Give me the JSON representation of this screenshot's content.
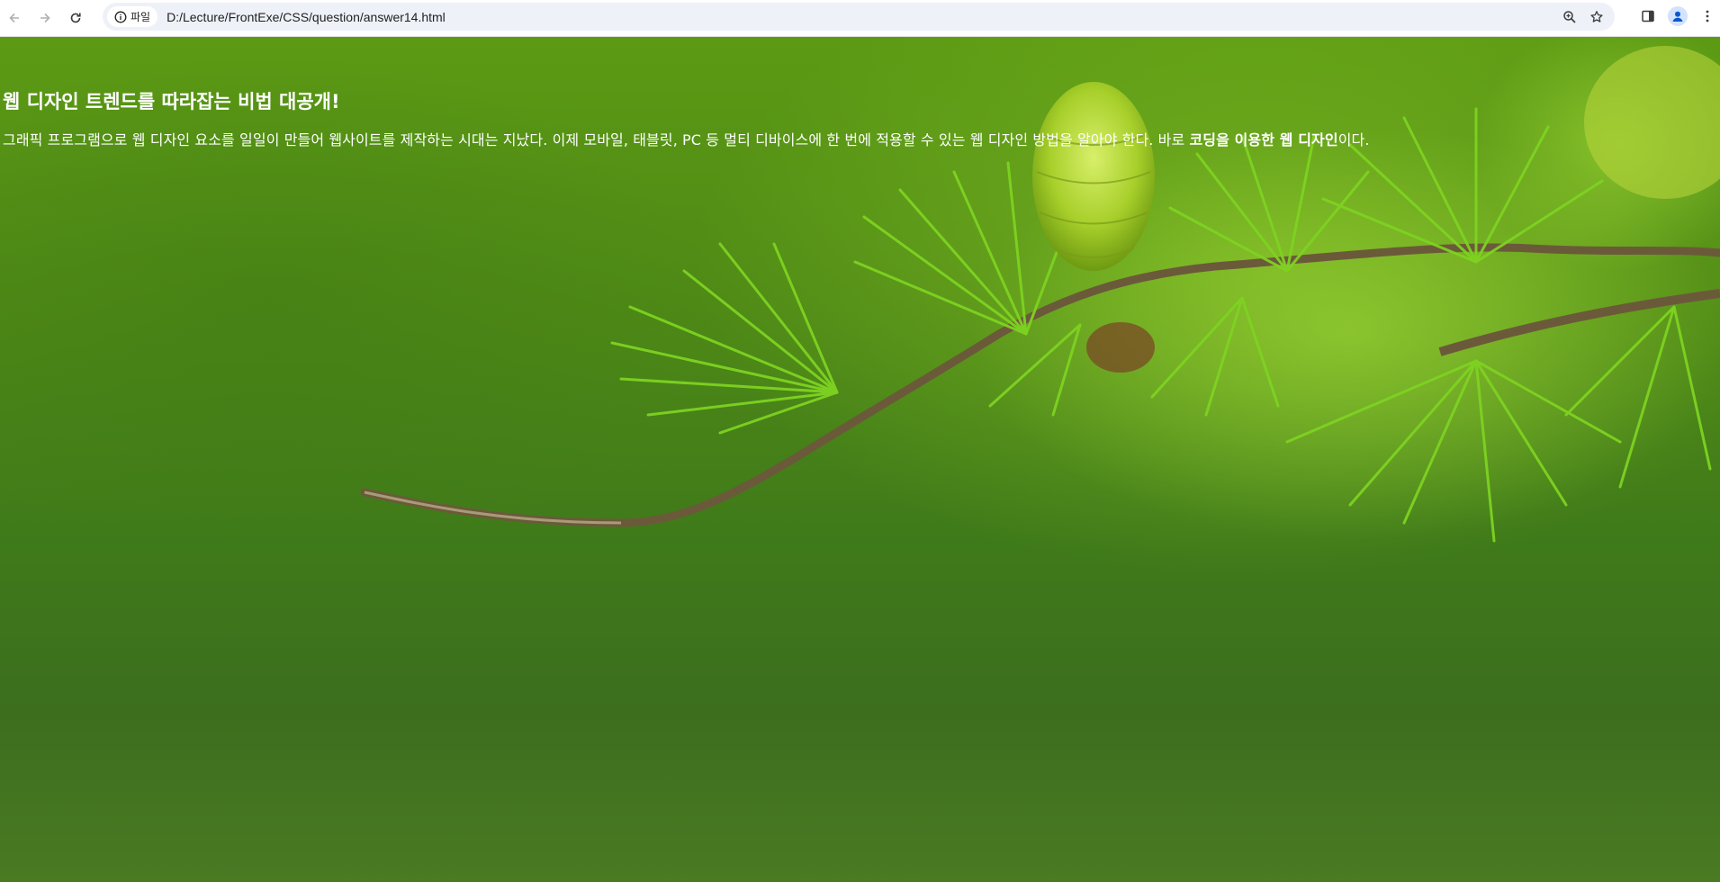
{
  "browser": {
    "back_icon": "arrow-left-icon",
    "forward_icon": "arrow-right-icon",
    "reload_icon": "reload-icon",
    "site_info_label": "파일",
    "url": "D:/Lecture/FrontExe/CSS/question/answer14.html",
    "zoom_icon": "zoom-icon",
    "bookmark_icon": "star-icon",
    "side_panel_icon": "side-panel-icon",
    "profile_icon": "profile-icon",
    "menu_icon": "kebab-menu-icon"
  },
  "page": {
    "heading": "웹 디자인 트렌드를 따라잡는 비법 대공개!",
    "paragraph_lead": "그래픽 프로그램으로 웹 디자인 요소를 일일이 만들어 웹사이트를 제작하는 시대는 지났다. 이제 모바일, 태블릿, PC 등 멀티 디바이스에 한 번에 적용할 수 있는 웹 디자인 방법을 알아야 한다. 바로 ",
    "paragraph_strong": "코딩을 이용한 웹 디자인",
    "paragraph_tail": "이다."
  },
  "colors": {
    "text": "#ffffff",
    "omnibox_bg": "#eef1f8",
    "background_green": "#4f8a16"
  }
}
